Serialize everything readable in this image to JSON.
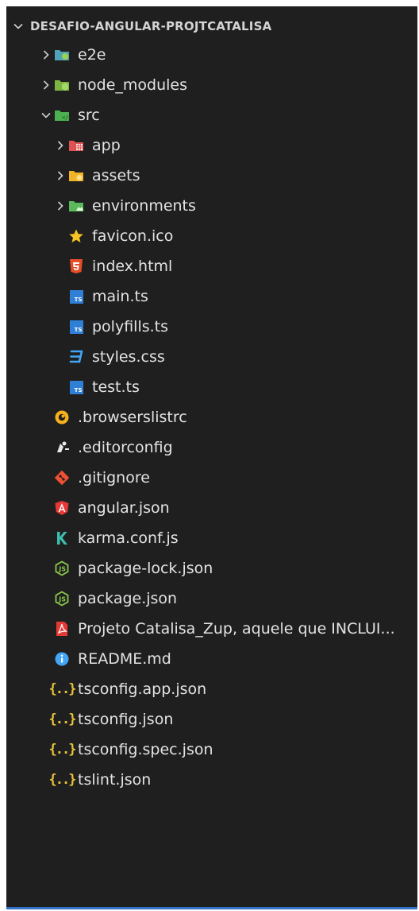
{
  "explorer": {
    "title": "DESAFIO-ANGULAR-PROJTCATALISA",
    "items": [
      {
        "label": "e2e",
        "icon": "folder-e2e-icon",
        "depth": 1,
        "chevron": "right"
      },
      {
        "label": "node_modules",
        "icon": "folder-node-icon",
        "depth": 1,
        "chevron": "right"
      },
      {
        "label": "src",
        "icon": "folder-src-icon",
        "depth": 1,
        "chevron": "down"
      },
      {
        "label": "app",
        "icon": "folder-app-icon",
        "depth": 2,
        "chevron": "right"
      },
      {
        "label": "assets",
        "icon": "folder-assets-icon",
        "depth": 2,
        "chevron": "right"
      },
      {
        "label": "environments",
        "icon": "folder-environments-icon",
        "depth": 2,
        "chevron": "right"
      },
      {
        "label": "favicon.ico",
        "icon": "star-icon",
        "depth": 2,
        "chevron": ""
      },
      {
        "label": "index.html",
        "icon": "html5-icon",
        "depth": 2,
        "chevron": ""
      },
      {
        "label": "main.ts",
        "icon": "typescript-icon",
        "depth": 2,
        "chevron": ""
      },
      {
        "label": "polyfills.ts",
        "icon": "typescript-icon",
        "depth": 2,
        "chevron": ""
      },
      {
        "label": "styles.css",
        "icon": "css3-icon",
        "depth": 2,
        "chevron": ""
      },
      {
        "label": "test.ts",
        "icon": "typescript-icon",
        "depth": 2,
        "chevron": ""
      },
      {
        "label": ".browserslistrc",
        "icon": "browserslist-icon",
        "depth": 1,
        "chevron": ""
      },
      {
        "label": ".editorconfig",
        "icon": "editorconfig-icon",
        "depth": 1,
        "chevron": ""
      },
      {
        "label": ".gitignore",
        "icon": "git-icon",
        "depth": 1,
        "chevron": ""
      },
      {
        "label": "angular.json",
        "icon": "angular-icon",
        "depth": 1,
        "chevron": ""
      },
      {
        "label": "karma.conf.js",
        "icon": "karma-icon",
        "depth": 1,
        "chevron": ""
      },
      {
        "label": "package-lock.json",
        "icon": "nodejs-icon",
        "depth": 1,
        "chevron": ""
      },
      {
        "label": "package.json",
        "icon": "nodejs-icon",
        "depth": 1,
        "chevron": ""
      },
      {
        "label": "Projeto Catalisa_Zup, aquele que INCLUI...",
        "icon": "pdf-icon",
        "depth": 1,
        "chevron": ""
      },
      {
        "label": "README.md",
        "icon": "info-icon",
        "depth": 1,
        "chevron": ""
      },
      {
        "label": "tsconfig.app.json",
        "icon": "json-icon",
        "depth": 1,
        "chevron": ""
      },
      {
        "label": "tsconfig.json",
        "icon": "json-icon",
        "depth": 1,
        "chevron": ""
      },
      {
        "label": "tsconfig.spec.json",
        "icon": "json-icon",
        "depth": 1,
        "chevron": ""
      },
      {
        "label": "tslint.json",
        "icon": "json-icon",
        "depth": 1,
        "chevron": ""
      }
    ]
  },
  "colors": {
    "background": "#1f1f1f",
    "text": "#e3e3e3",
    "accent": "#2f72c8"
  }
}
